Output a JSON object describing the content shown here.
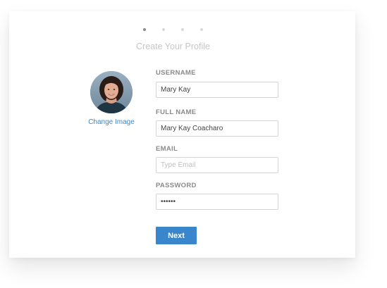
{
  "steps": {
    "count": 4,
    "active": 1
  },
  "title": "Create Your Profile",
  "avatar": {
    "change_label": "Change Image"
  },
  "form": {
    "username": {
      "label": "USERNAME",
      "value": "Mary Kay"
    },
    "full_name": {
      "label": "FULL NAME",
      "value": "Mary Kay Coacharo"
    },
    "email": {
      "label": "EMAIL",
      "value": "",
      "placeholder": "Type Email"
    },
    "password": {
      "label": "PASSWORD",
      "value": "••••••"
    }
  },
  "next_label": "Next",
  "colors": {
    "accent": "#3a86cc",
    "link": "#3c88c6"
  }
}
